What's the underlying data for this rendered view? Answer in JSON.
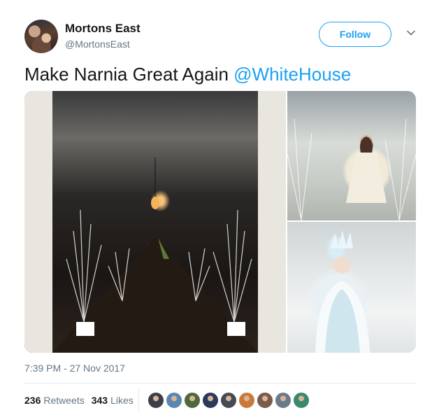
{
  "user": {
    "name": "Mortons East",
    "handle": "@MortonsEast"
  },
  "follow_label": "Follow",
  "tweet": {
    "text": "Make Narnia Great Again ",
    "mention": "@WhiteHouse"
  },
  "timestamp": "7:39 PM - 27 Nov 2017",
  "stats": {
    "retweets_count": "236",
    "retweets_label": "Retweets",
    "likes_count": "343",
    "likes_label": "Likes"
  },
  "likers": [
    {
      "color": "#3a3f4a"
    },
    {
      "color": "#5b86b0"
    },
    {
      "color": "#4f6a3a"
    },
    {
      "color": "#2a3a5a"
    },
    {
      "color": "#444b52"
    },
    {
      "color": "#c87a3a"
    },
    {
      "color": "#7a5a4a"
    },
    {
      "color": "#6a7a8a"
    },
    {
      "color": "#3a8a6a"
    }
  ],
  "colors": {
    "accent": "#1da1f2",
    "secondary_text": "#657786"
  }
}
